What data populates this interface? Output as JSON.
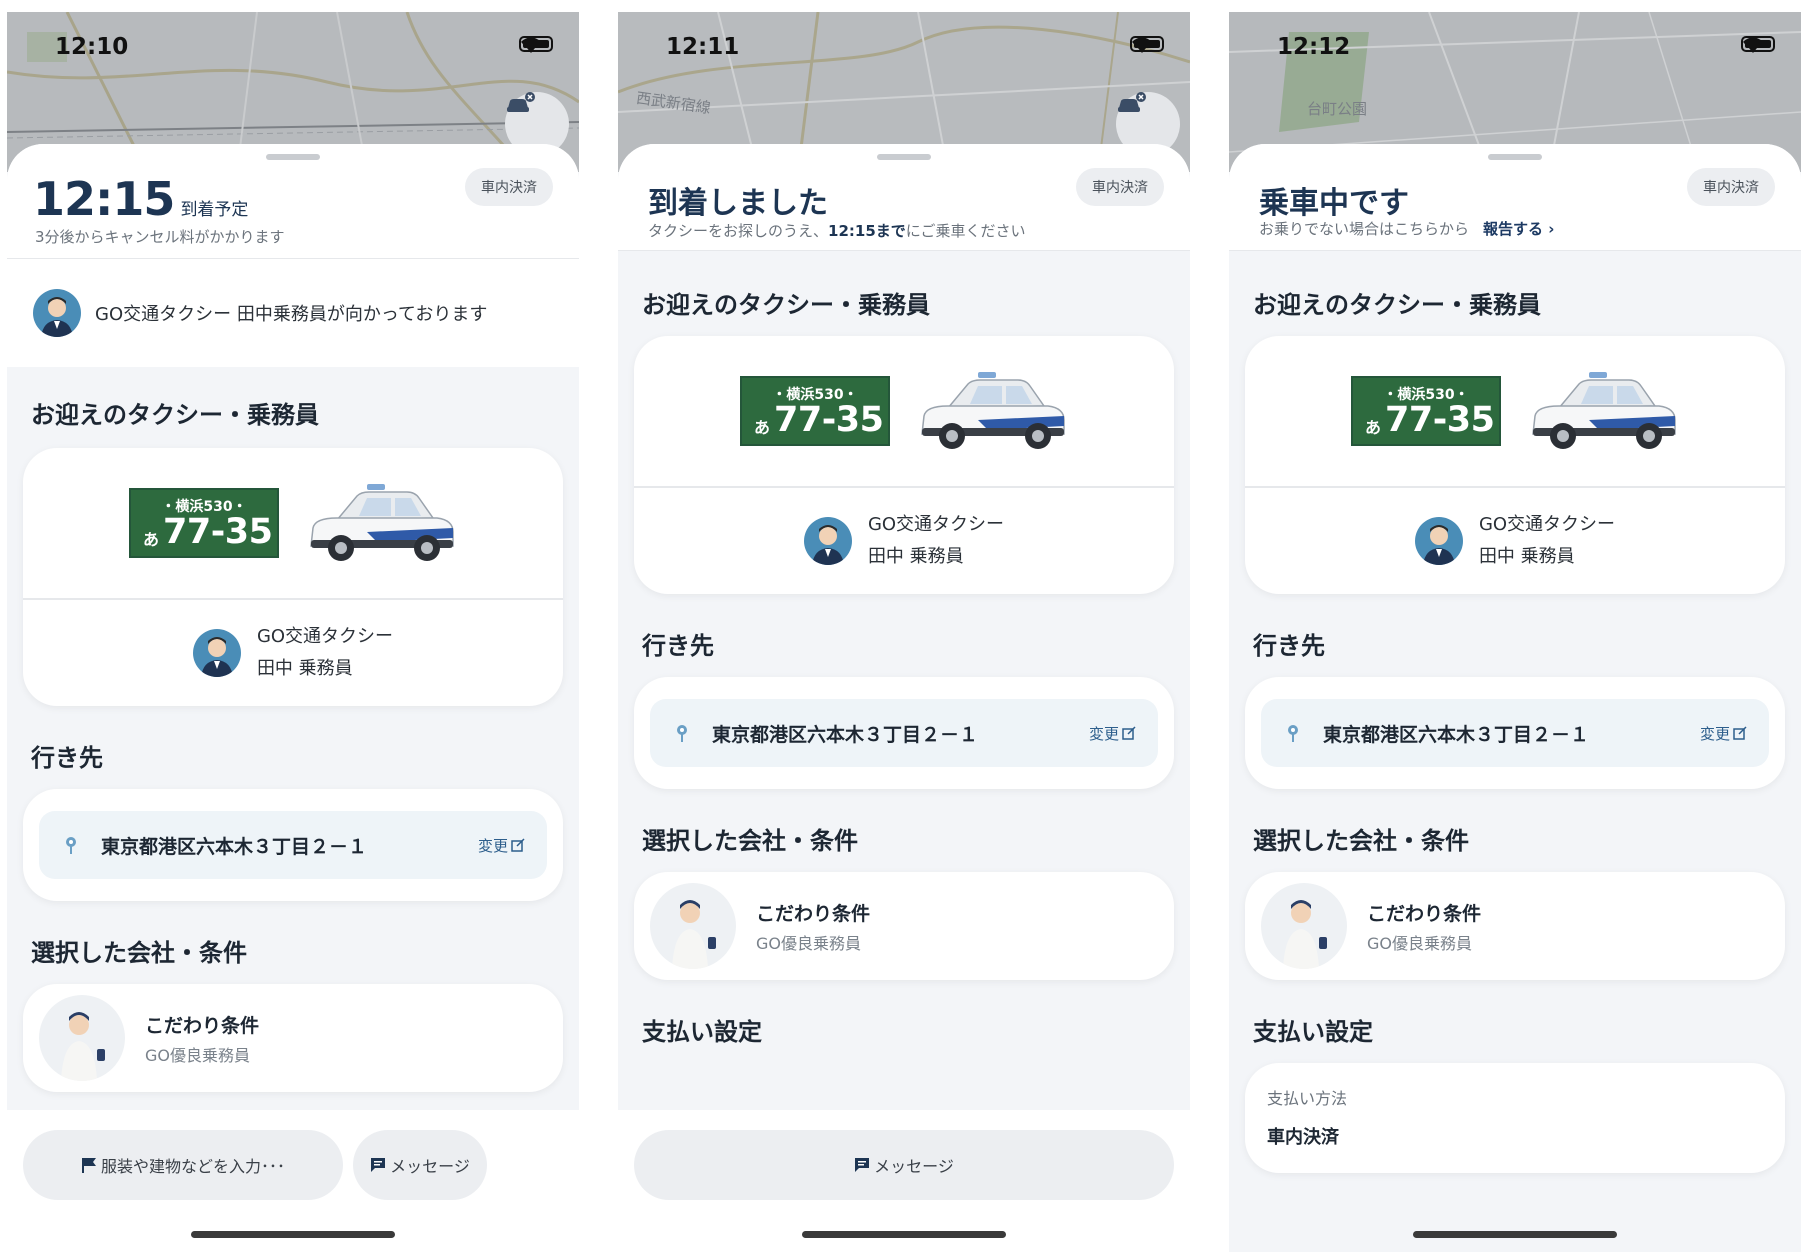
{
  "colors": {
    "navy": "#1d3553",
    "plate_green": "#2d6a3e",
    "sheet_bg": "#f3f5f8",
    "map_gray": "#b9bcbf"
  },
  "screens": [
    {
      "status_time": "12:10",
      "payment_chip": "車内決済",
      "eta_time": "12:15",
      "eta_label": "到着予定",
      "subtext": "3分後からキャンセル料がかかります",
      "approach_text": "GO交通タクシー 田中乗務員が向かっております",
      "section_pickup": "お迎えのタクシー・乗務員",
      "plate_region": "・横浜530・",
      "plate_kana": "あ",
      "plate_number": "77-35",
      "company": "GO交通タクシー",
      "driver": "田中 乗務員",
      "section_dest": "行き先",
      "destination": "東京都港区六本木３丁目２－１",
      "change_label": "変更",
      "section_conditions": "選択した会社・条件",
      "cond_title": "こだわり条件",
      "cond_sub": "GO優良乗務員",
      "hint_button": "服装や建物などを入力･･･",
      "message_button": "メッセージ"
    },
    {
      "status_time": "12:11",
      "map_label": "西武新宿線",
      "payment_chip": "車内決済",
      "title": "到着しました",
      "sub_before": "タクシーをお探しのうえ、",
      "sub_bold": "12:15まで",
      "sub_after": "にご乗車ください",
      "section_pickup": "お迎えのタクシー・乗務員",
      "plate_region": "・横浜530・",
      "plate_kana": "あ",
      "plate_number": "77-35",
      "company": "GO交通タクシー",
      "driver": "田中 乗務員",
      "section_dest": "行き先",
      "destination": "東京都港区六本木３丁目２－１",
      "change_label": "変更",
      "section_conditions": "選択した会社・条件",
      "cond_title": "こだわり条件",
      "cond_sub": "GO優良乗務員",
      "section_payment": "支払い設定",
      "message_button": "メッセージ"
    },
    {
      "status_time": "12:12",
      "map_label": "台町公園",
      "payment_chip": "車内決済",
      "title": "乗車中です",
      "sub_text": "お乗りでない場合はこちらから",
      "report_link": "報告する ›",
      "section_pickup": "お迎えのタクシー・乗務員",
      "plate_region": "・横浜530・",
      "plate_kana": "あ",
      "plate_number": "77-35",
      "company": "GO交通タクシー",
      "driver": "田中 乗務員",
      "section_dest": "行き先",
      "destination": "東京都港区六本木３丁目２－１",
      "change_label": "変更",
      "section_conditions": "選択した会社・条件",
      "cond_title": "こだわり条件",
      "cond_sub": "GO優良乗務員",
      "section_payment": "支払い設定",
      "payment_method_label": "支払い方法",
      "payment_method_value": "車内決済"
    }
  ]
}
